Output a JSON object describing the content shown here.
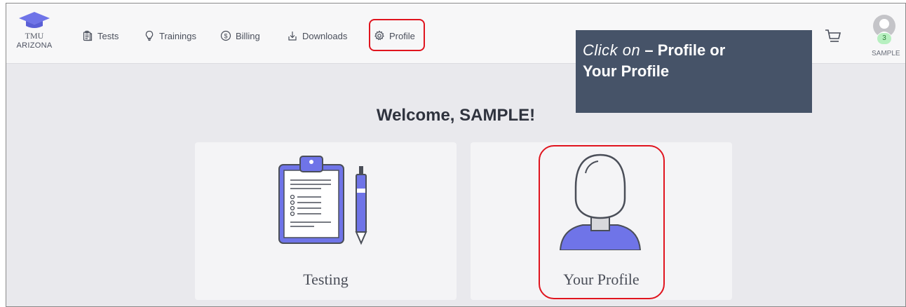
{
  "brand": {
    "line1": "TMU",
    "line2": "ARIZONA",
    "color": "#6f74e8"
  },
  "nav": {
    "items": [
      {
        "label": "Tests",
        "icon": "clipboard-icon"
      },
      {
        "label": "Trainings",
        "icon": "lightbulb-icon"
      },
      {
        "label": "Billing",
        "icon": "dollar-circle-icon"
      },
      {
        "label": "Downloads",
        "icon": "download-icon"
      },
      {
        "label": "Profile",
        "icon": "gear-icon"
      }
    ]
  },
  "header": {
    "cart_icon": "cart-icon",
    "badge_count": "3",
    "user_name": "SAMPLE"
  },
  "callout": {
    "prefix": "Click on",
    "dash": " – ",
    "line1_rest": "Profile or",
    "line2": "Your Profile"
  },
  "main": {
    "welcome": "Welcome, SAMPLE!",
    "cards": [
      {
        "label": "Testing",
        "icon": "clipboard-pen-icon"
      },
      {
        "label": "Your Profile",
        "icon": "user-profile-icon"
      }
    ]
  },
  "colors": {
    "accent": "#6f74e8",
    "highlight": "#e0141e",
    "callout_bg": "#465368"
  }
}
